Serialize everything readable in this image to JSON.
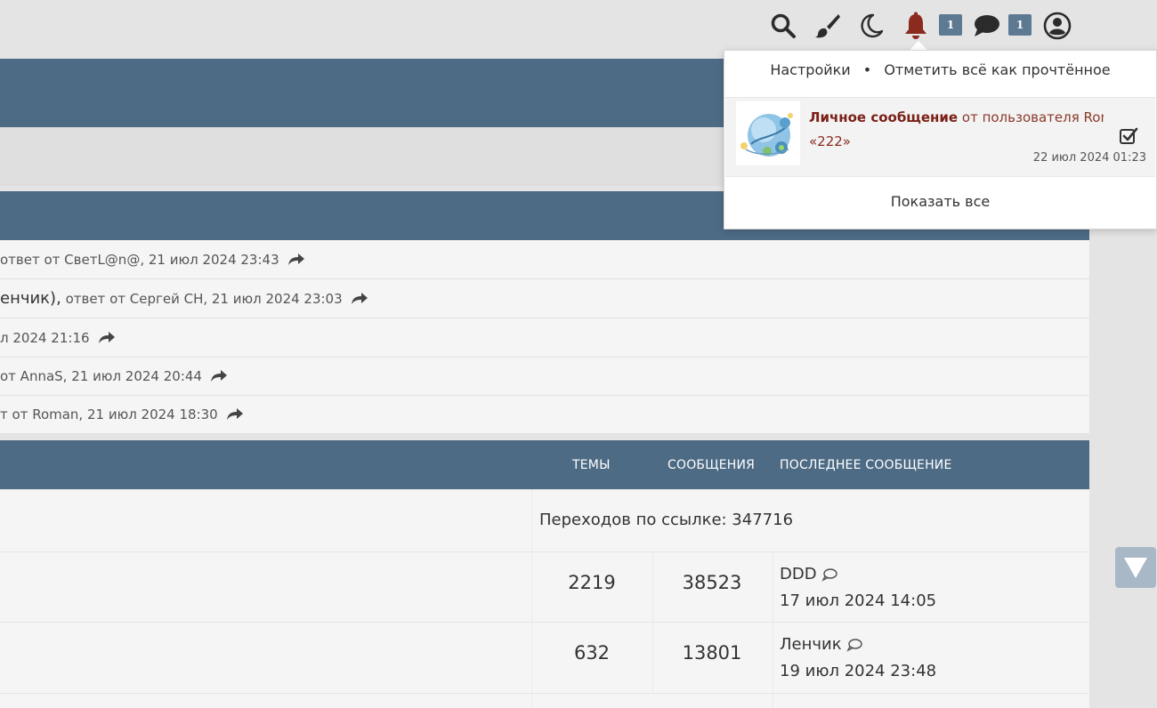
{
  "topbar": {
    "icons": [
      "search-icon",
      "brush-icon",
      "moon-icon",
      "bell-icon",
      "chat-icon",
      "user-icon"
    ],
    "notifications_count": "1",
    "messages_count": "1",
    "bell_color": "#8b2a1e"
  },
  "notifications": {
    "settings_label": "Настройки",
    "separator": "•",
    "mark_all_read_label": "Отметить всё как прочтённое",
    "item": {
      "title": "Личное сообщение",
      "from_text": "от пользователя Roma",
      "subject": "«222»",
      "time": "22 июл 2024 01:23"
    },
    "show_all_label": "Показать все"
  },
  "recent_posts": [
    {
      "prefix": "",
      "text": "ответ от СветL@n@, 21 июл 2024 23:43"
    },
    {
      "prefix": "енчик),",
      "text": "ответ от Сергей СН, 21 июл 2024 23:03"
    },
    {
      "prefix": "",
      "text": "л 2024 21:16"
    },
    {
      "prefix": "",
      "text": "от AnnaS, 21 июл 2024 20:44"
    },
    {
      "prefix": "",
      "text": "т от Roman, 21 июл 2024 18:30"
    }
  ],
  "forum_table": {
    "headers": {
      "topics": "ТЕМЫ",
      "posts": "СООБЩЕНИЯ",
      "last_post": "ПОСЛЕДНЕЕ СООБЩЕНИЕ"
    },
    "link_row": "Переходов по ссылке: 347716",
    "rows": [
      {
        "topics": "2219",
        "posts": "38523",
        "last_user": "DDD",
        "last_date": "17 июл 2024 14:05"
      },
      {
        "topics": "632",
        "posts": "13801",
        "last_user": "Ленчик",
        "last_date": "19 июл 2024 23:48"
      }
    ]
  },
  "colors": {
    "header_blue": "#4e6b85",
    "badge_blue": "#5e7a93",
    "notification_title": "#7a2016"
  }
}
